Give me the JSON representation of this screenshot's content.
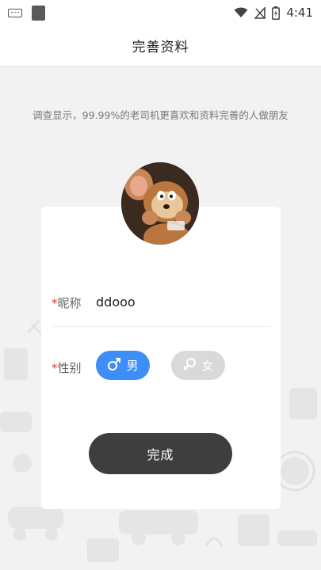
{
  "status_bar": {
    "time": "4:41",
    "icons": [
      "keyboard-icon",
      "notification-square-icon",
      "wifi-icon",
      "signal-icon",
      "battery-icon"
    ]
  },
  "header": {
    "title": "完善资料"
  },
  "tip": "调查显示，99.99%的老司机更喜欢和资料完善的人做朋友",
  "form": {
    "required_mark": "*",
    "nickname_label": "昵称",
    "nickname_value": "ddooo",
    "gender_label": "性别",
    "male_label": "男",
    "female_label": "女",
    "selected_gender": "male",
    "submit_label": "完成"
  },
  "colors": {
    "accent": "#3d8ef7",
    "required": "#e03a3a",
    "submit_bg": "#3e3e3e",
    "inactive": "#d9d9d9"
  }
}
